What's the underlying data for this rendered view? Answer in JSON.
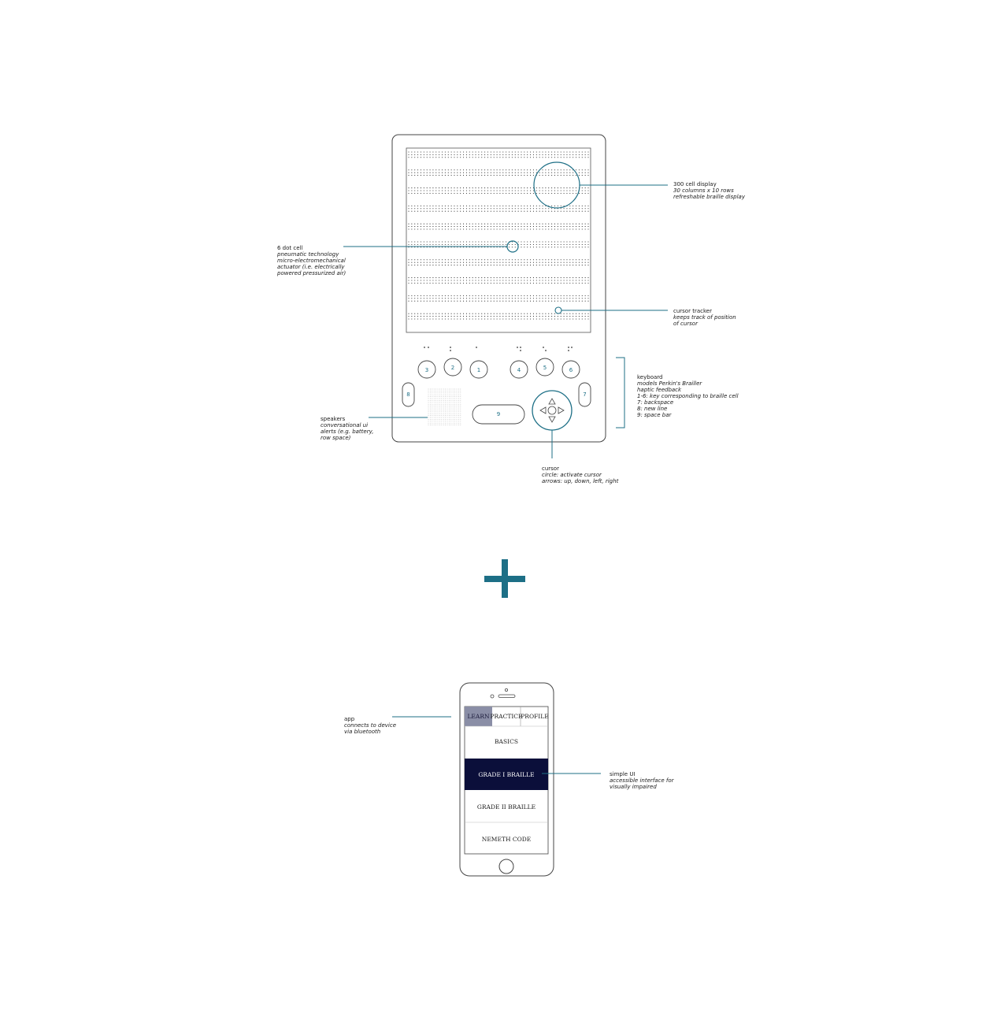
{
  "colors": {
    "accent": "#1d6f86",
    "line": "#333333",
    "app_tab_active": "#8a8ea6",
    "app_row_active": "#0b0f3a"
  },
  "device": {
    "keys": {
      "k1": "1",
      "k2": "2",
      "k3": "3",
      "k4": "4",
      "k5": "5",
      "k6": "6",
      "k7": "7",
      "k8": "8",
      "k9": "9"
    },
    "braille_display": {
      "columns": 30,
      "rows": 10
    }
  },
  "annotations": {
    "display": {
      "title": "300 cell display",
      "desc": [
        "30 columns x 10 rows",
        "refreshable braille display"
      ]
    },
    "dot_cell": {
      "title": "6 dot cell",
      "desc": [
        "pneumatic technology",
        "micro-electromechanical",
        "actuator (i.e. electrically",
        "powered pressurized air)"
      ]
    },
    "cursor_tracker": {
      "title": "cursor tracker",
      "desc": [
        "keeps track of position",
        "of cursor"
      ]
    },
    "keyboard": {
      "title": "keyboard",
      "desc": [
        "models Perkin's Brailler",
        "haptic feedback",
        "1-6: key corresponding to braille cell",
        "7: backspace",
        "8: new line",
        "9: space bar"
      ]
    },
    "speakers": {
      "title": "speakers",
      "desc": [
        "conversational ui",
        "alerts (e.g. battery,",
        "row space)"
      ]
    },
    "cursor": {
      "title": "cursor",
      "desc": [
        "circle: activate cursor",
        "arrows: up, down, left, right"
      ]
    },
    "app": {
      "title": "app",
      "desc": [
        "connects to device",
        "via bluetooth"
      ]
    },
    "simple_ui": {
      "title": "simple UI",
      "desc": [
        "accessible interface for",
        "visually impaired"
      ]
    }
  },
  "app": {
    "tabs": [
      "LEARN",
      "PRACTICE",
      "PROFILE"
    ],
    "active_tab": 0,
    "rows": [
      "BASICS",
      "GRADE I BRAILLE",
      "GRADE II BRAILLE",
      "NEMETH CODE"
    ],
    "active_row": 1
  }
}
